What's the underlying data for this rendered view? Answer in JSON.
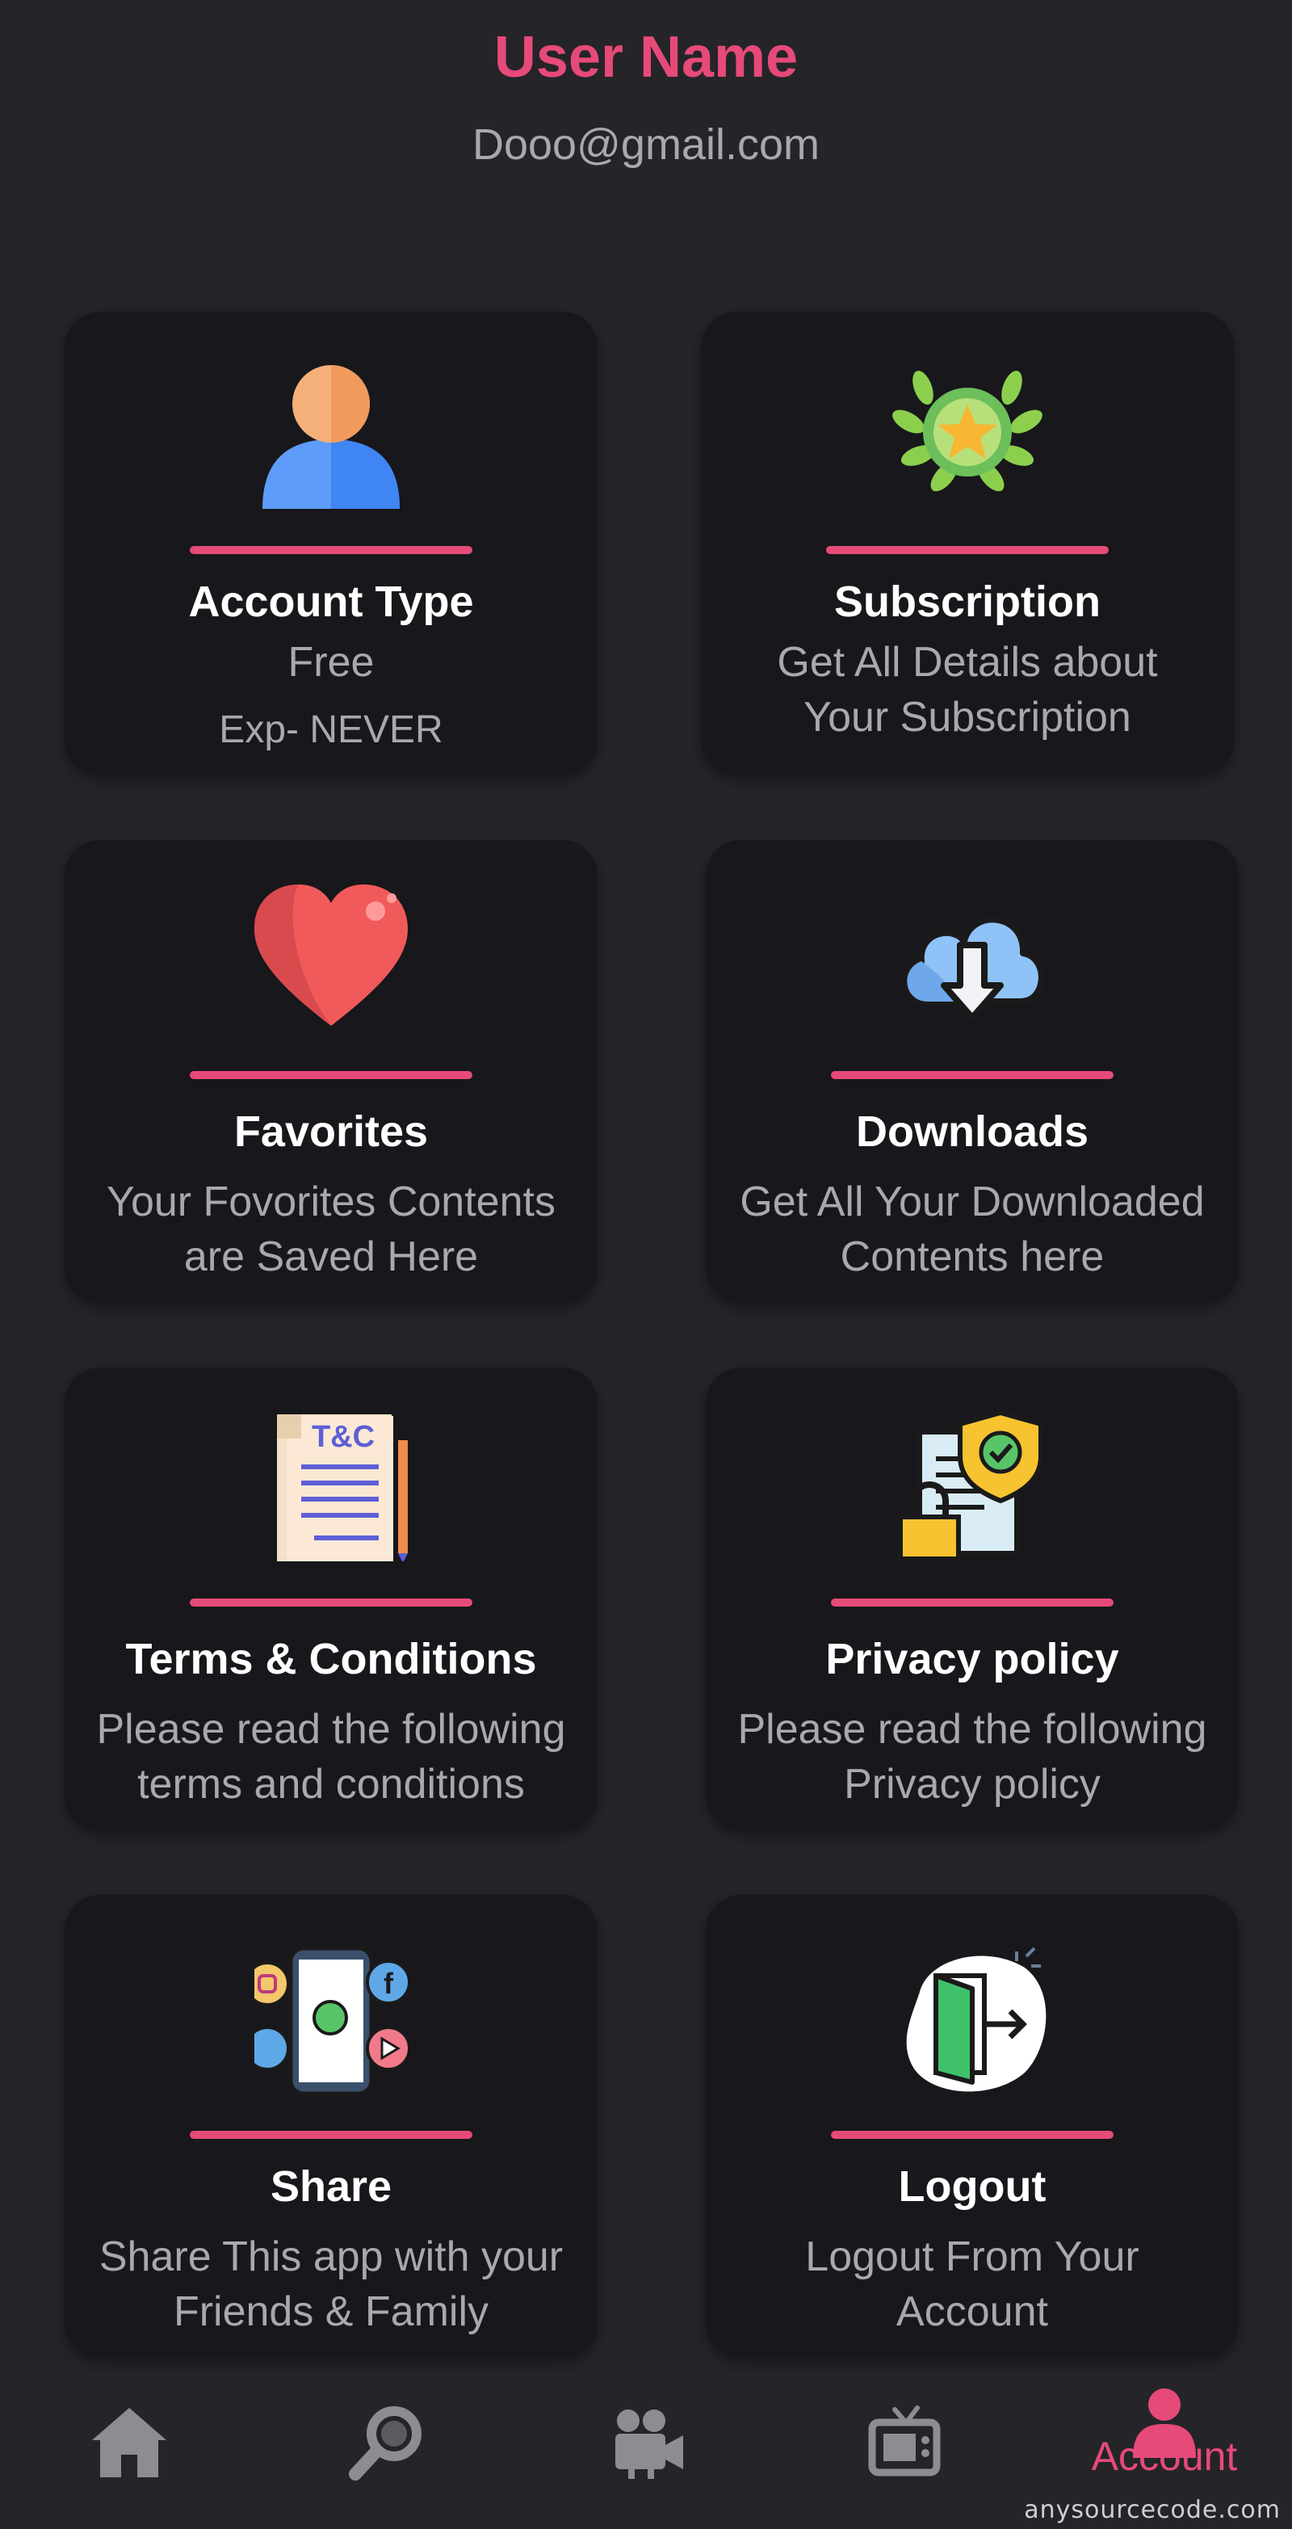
{
  "user": {
    "name": "User Name",
    "email": "Dooo@gmail.com"
  },
  "cards": [
    {
      "title": "Account Type",
      "line1": "Free",
      "line2": "Exp- NEVER",
      "icon": "user-avatar-icon"
    },
    {
      "title": "Subscription",
      "line1": "Get All Details about",
      "line2": "Your Subscription",
      "icon": "laurel-star-icon"
    },
    {
      "title": "Favorites",
      "line1": "Your Fovorites Contents",
      "line2": "are Saved Here",
      "icon": "heart-icon"
    },
    {
      "title": "Downloads",
      "line1": "Get All Your Downloaded",
      "line2": "Contents here",
      "icon": "cloud-download-icon"
    },
    {
      "title": "Terms & Conditions",
      "line1": "Please read the following",
      "line2": "terms and conditions",
      "icon": "terms-document-icon"
    },
    {
      "title": "Privacy policy",
      "line1": "Please read the following",
      "line2": "Privacy policy",
      "icon": "privacy-shield-icon"
    },
    {
      "title": "Share",
      "line1": "Share This app with your",
      "line2": "Friends & Family",
      "icon": "share-social-icon"
    },
    {
      "title": "Logout",
      "line1": "Logout From Your",
      "line2": "Account",
      "icon": "logout-door-icon"
    }
  ],
  "icon_labels": {
    "terms": "T&C"
  },
  "nav": {
    "items": [
      "home-icon",
      "search-icon",
      "video-camera-icon",
      "tv-icon",
      "account-icon"
    ],
    "active_label": "Account",
    "active_index": 4
  },
  "watermark": "anysourcecode.com",
  "colors": {
    "accent": "#e64a78",
    "background": "#252429",
    "card": "#18171b",
    "muted": "#a9a8ad",
    "nav_inactive": "#8d8c91"
  }
}
